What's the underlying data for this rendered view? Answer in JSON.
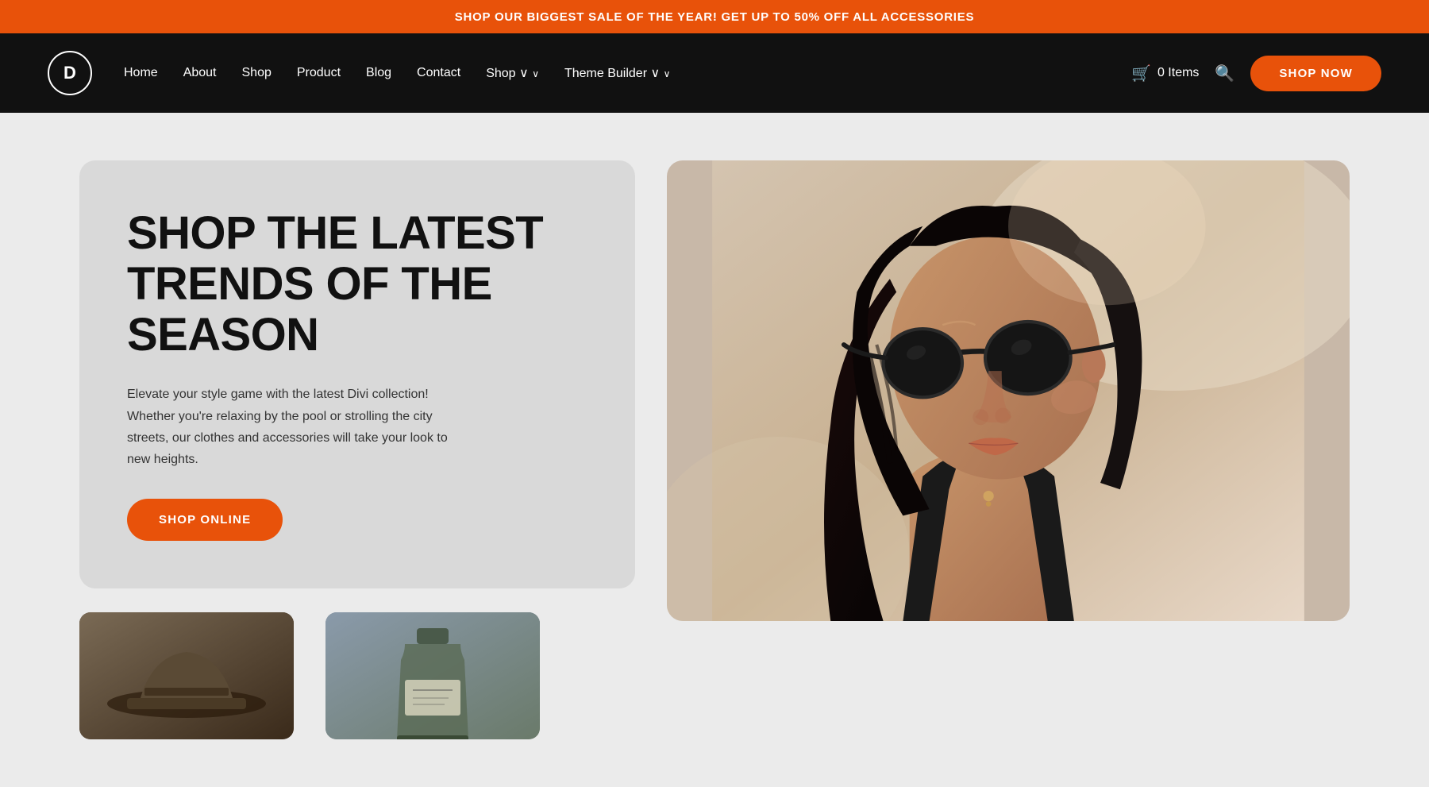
{
  "banner": {
    "text": "SHOP OUR BIGGEST SALE OF THE YEAR! GET UP TO 50% OFF ALL ACCESSORIES"
  },
  "navbar": {
    "logo_letter": "D",
    "links": [
      {
        "label": "Home",
        "has_dropdown": false
      },
      {
        "label": "About",
        "has_dropdown": false
      },
      {
        "label": "Shop",
        "has_dropdown": false
      },
      {
        "label": "Product",
        "has_dropdown": false
      },
      {
        "label": "Blog",
        "has_dropdown": false
      },
      {
        "label": "Contact",
        "has_dropdown": false
      },
      {
        "label": "Shop",
        "has_dropdown": true
      },
      {
        "label": "Theme Builder",
        "has_dropdown": true
      }
    ],
    "cart": {
      "icon": "🛒",
      "label": "0 Items"
    },
    "search_icon": "🔍",
    "cta_button": "SHOP NOW"
  },
  "hero": {
    "title": "SHOP THE LATEST TRENDS OF THE SEASON",
    "description": "Elevate your style game with the latest Divi collection! Whether you're relaxing by the pool or strolling the city streets, our clothes and accessories will take your look to new heights.",
    "cta_button": "SHOP ONLINE"
  },
  "colors": {
    "orange": "#e8520a",
    "black": "#111111",
    "dark_gray": "#d9d9d9",
    "bg": "#ebebeb"
  }
}
